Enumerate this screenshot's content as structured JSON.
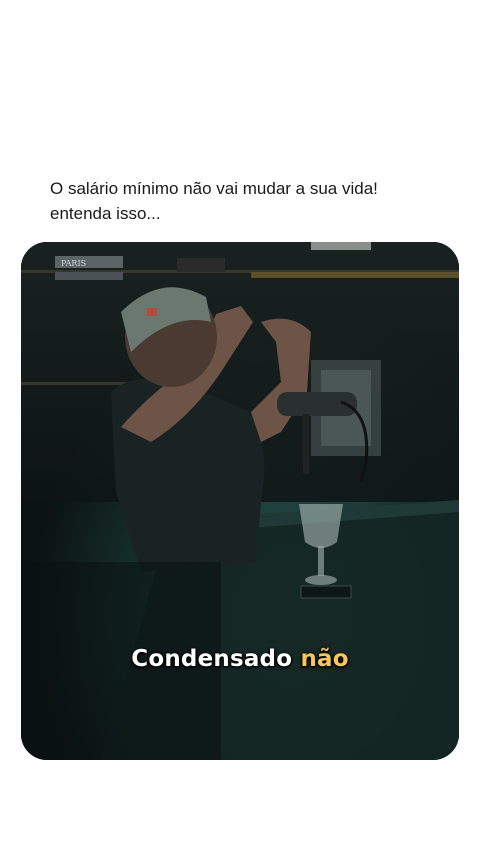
{
  "post": {
    "caption_line1": "O salário mínimo não vai mudar a sua vida!",
    "caption_line2": "entenda isso..."
  },
  "video": {
    "subtitle_main": "Condensado",
    "subtitle_highlight": "não",
    "subtitle_highlight_color": "#f6c85a",
    "book_label": "PARIS"
  },
  "colors": {
    "background": "#ffffff",
    "caption_text": "#1a1a1a",
    "video_bg": "#0d1414"
  }
}
